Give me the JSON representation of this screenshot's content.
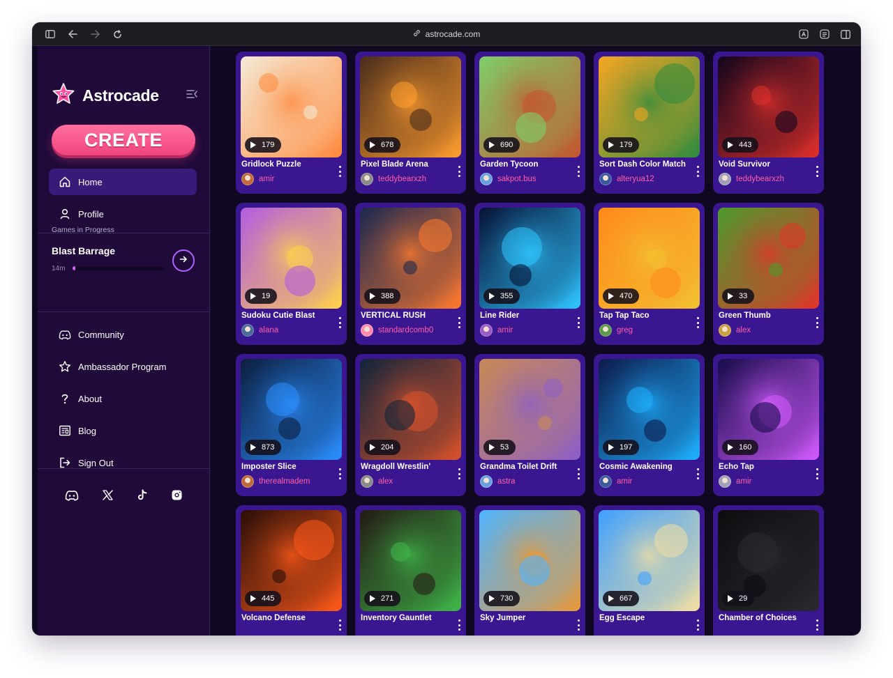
{
  "browser": {
    "url": "astrocade.com"
  },
  "sidebar": {
    "brand": "Astrocade",
    "create_label": "CREATE",
    "nav": [
      {
        "label": "Home",
        "icon": "home-icon",
        "active": true
      },
      {
        "label": "Profile",
        "icon": "user-icon",
        "active": false
      }
    ],
    "games_in_progress": {
      "label": "Games in Progress",
      "title": "Blast Barrage",
      "time": "14m",
      "progress": 0.03
    },
    "links": [
      {
        "label": "Community",
        "icon": "discord-icon"
      },
      {
        "label": "Ambassador Program",
        "icon": "star-icon"
      },
      {
        "label": "About",
        "icon": "question-icon"
      },
      {
        "label": "Blog",
        "icon": "newspaper-icon"
      },
      {
        "label": "Sign Out",
        "icon": "sign-out-icon"
      }
    ],
    "socials": [
      "discord-icon",
      "x-icon",
      "tiktok-icon",
      "instagram-icon"
    ]
  },
  "games": [
    {
      "title": "Gridlock Puzzle",
      "author": "amir",
      "plays": "179",
      "colors": [
        "#f4ead6",
        "#ff8a3d"
      ]
    },
    {
      "title": "Pixel Blade Arena",
      "author": "teddybearxzh",
      "plays": "678",
      "colors": [
        "#4a2d1c",
        "#ff9d2e"
      ]
    },
    {
      "title": "Garden Tycoon",
      "author": "sakpot.bus",
      "plays": "690",
      "colors": [
        "#7ecf6b",
        "#c4542f"
      ]
    },
    {
      "title": "Sort Dash Color Match",
      "author": "alteryua12",
      "plays": "179",
      "colors": [
        "#f5a623",
        "#2e8b3e"
      ]
    },
    {
      "title": "Void Survivor",
      "author": "teddybearxzh",
      "plays": "443",
      "colors": [
        "#12061c",
        "#e0302b"
      ]
    },
    {
      "title": "Sudoku Cutie Blast",
      "author": "alana",
      "plays": "19",
      "colors": [
        "#b25ce0",
        "#ffd24a"
      ]
    },
    {
      "title": "VERTICAL RUSH",
      "author": "standardcomb0",
      "plays": "388",
      "colors": [
        "#1a2850",
        "#ff7a2e"
      ]
    },
    {
      "title": "Line Rider",
      "author": "amir",
      "plays": "355",
      "colors": [
        "#071236",
        "#2fc6ff"
      ]
    },
    {
      "title": "Tap Tap Taco",
      "author": "greg",
      "plays": "470",
      "colors": [
        "#ff8a1a",
        "#f2c132"
      ]
    },
    {
      "title": "Green Thumb",
      "author": "alex",
      "plays": "33",
      "colors": [
        "#4d9a2c",
        "#e0342b"
      ]
    },
    {
      "title": "Imposter Slice",
      "author": "therealmadem",
      "plays": "873",
      "colors": [
        "#0c1e3e",
        "#2b8fff"
      ]
    },
    {
      "title": "Wragdoll Wrestlin'",
      "author": "alex",
      "plays": "204",
      "colors": [
        "#10243a",
        "#d8522c"
      ]
    },
    {
      "title": "Grandma Toilet Drift",
      "author": "astra",
      "plays": "53",
      "colors": [
        "#c88a54",
        "#8c5ec8"
      ]
    },
    {
      "title": "Cosmic Awakening",
      "author": "amir",
      "plays": "197",
      "colors": [
        "#0c1a4a",
        "#1fb0ff"
      ]
    },
    {
      "title": "Echo Tap",
      "author": "amir",
      "plays": "160",
      "colors": [
        "#160c4a",
        "#d35bff"
      ]
    },
    {
      "title": "Volcano Defense",
      "author": "",
      "plays": "445",
      "colors": [
        "#2a0f08",
        "#ff5a1a"
      ]
    },
    {
      "title": "Inventory Gauntlet",
      "author": "",
      "plays": "271",
      "colors": [
        "#241a14",
        "#3fb84a"
      ]
    },
    {
      "title": "Sky Jumper",
      "author": "",
      "plays": "730",
      "colors": [
        "#4fb4ff",
        "#e8993a"
      ]
    },
    {
      "title": "Egg Escape",
      "author": "",
      "plays": "667",
      "colors": [
        "#3fa0ff",
        "#f3dfa0"
      ]
    },
    {
      "title": "Chamber of Choices",
      "author": "",
      "plays": "29",
      "colors": [
        "#0d0d10",
        "#2a2a30"
      ]
    }
  ]
}
